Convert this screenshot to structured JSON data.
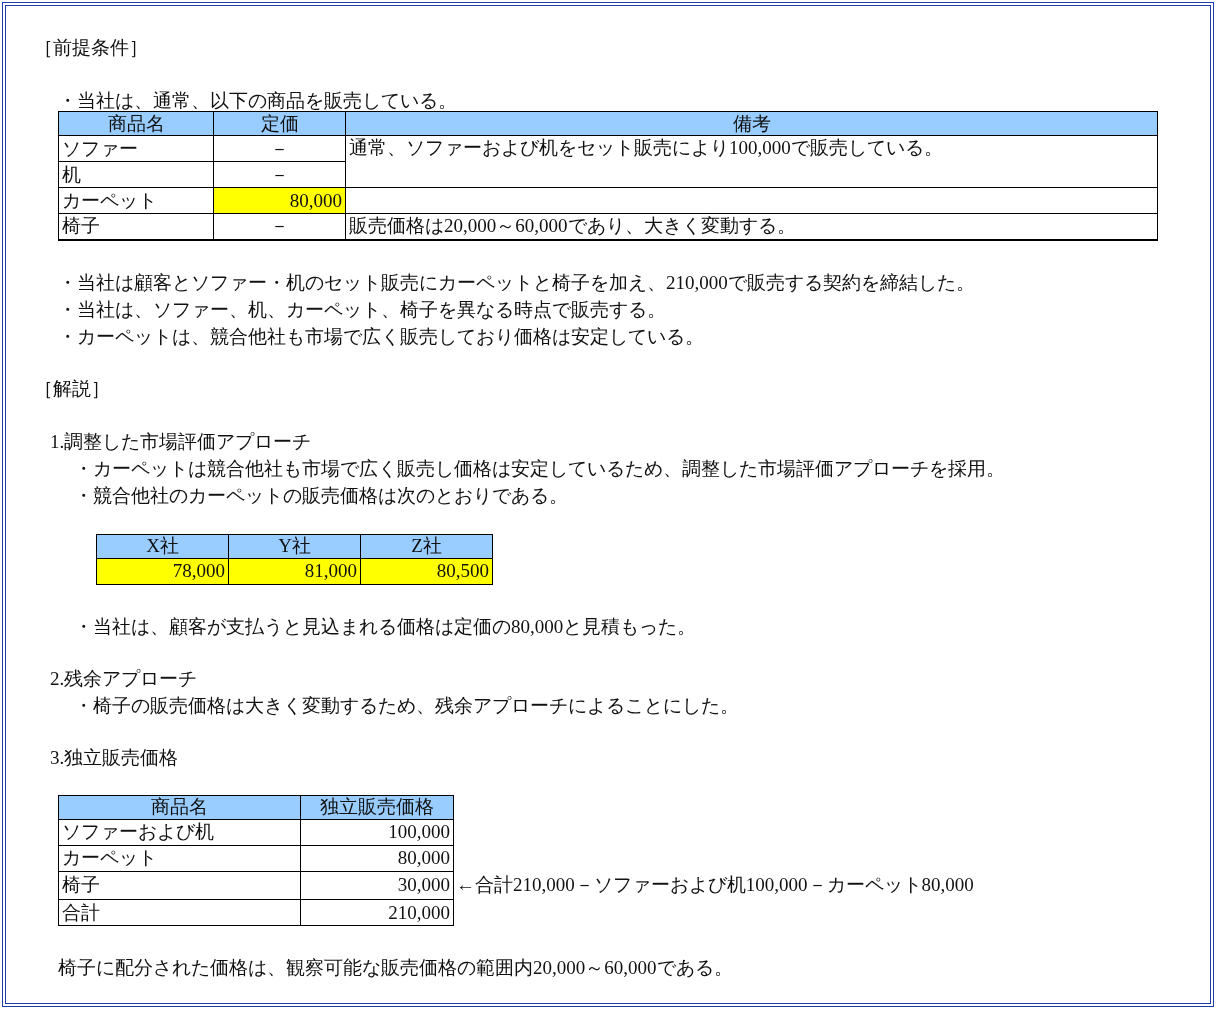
{
  "premise": {
    "heading": "［前提条件］",
    "intro": "・当社は、通常、以下の商品を販売している。",
    "table": {
      "columns": [
        "商品名",
        "定価",
        "備考"
      ],
      "rows": [
        {
          "kind": "unpriced",
          "name": "ソファー",
          "price": "－",
          "price_highlighted": false,
          "note": "通常、ソファーおよび机をセット販売により100,000で販売している。",
          "note_spans_next_row": true
        },
        {
          "kind": "unpriced",
          "name": "机",
          "price": "－",
          "price_highlighted": false
        },
        {
          "kind": "priced",
          "name": "カーペット",
          "price": "80,000",
          "price_highlighted": true,
          "note_spans_next_row": false
        },
        {
          "kind": "unpriced",
          "name": "椅子",
          "price": "－",
          "price_highlighted": false,
          "note": "販売価格は20,000～60,000であり、大きく変動する。",
          "note_spans_next_row": false
        }
      ]
    },
    "bullets": [
      "・当社は顧客とソファー・机のセット販売にカーペットと椅子を加え、210,000で販売する契約を締結した。",
      "・当社は、ソファー、机、カーペット、椅子を異なる時点で販売する。",
      "・カーペットは、競合他社も市場で広く販売しており価格は安定している。"
    ]
  },
  "explanation": {
    "heading": "［解説］",
    "section_1": {
      "title": "1.調整した市場評価アプローチ",
      "bullets": [
        "・カーペットは競合他社も市場で広く販売し価格は安定しているため、調整した市場評価アプローチを採用。",
        "・競合他社のカーペットの販売価格は次のとおりである。"
      ],
      "table": {
        "columns": [
          "X社",
          "Y社",
          "Z社"
        ],
        "values": [
          {
            "text": "78,000",
            "highlighted": true
          },
          {
            "text": "81,000",
            "highlighted": true
          },
          {
            "text": "80,500",
            "highlighted": true
          }
        ]
      },
      "after_bullet": "・当社は、顧客が支払うと見込まれる価格は定価の80,000と見積もった。"
    },
    "section_2": {
      "title": "2.残余アプローチ",
      "bullets": [
        "・椅子の販売価格は大きく変動するため、残余アプローチによることにした。"
      ]
    },
    "section_3": {
      "title": "3.独立販売価格",
      "table": {
        "columns": [
          "商品名",
          "独立販売価格"
        ],
        "rows": [
          {
            "name": "ソファーおよび机",
            "price": "100,000"
          },
          {
            "name": "カーペット",
            "price": "80,000"
          },
          {
            "name": "椅子",
            "price": "30,000",
            "annotation": "←合計210,000－ソファーおよび机100,000－カーペット80,000"
          },
          {
            "name": "合計",
            "price": "210,000"
          }
        ]
      },
      "conclusion": "椅子に配分された価格は、観察可能な販売価格の範囲内20,000～60,000である。"
    }
  }
}
